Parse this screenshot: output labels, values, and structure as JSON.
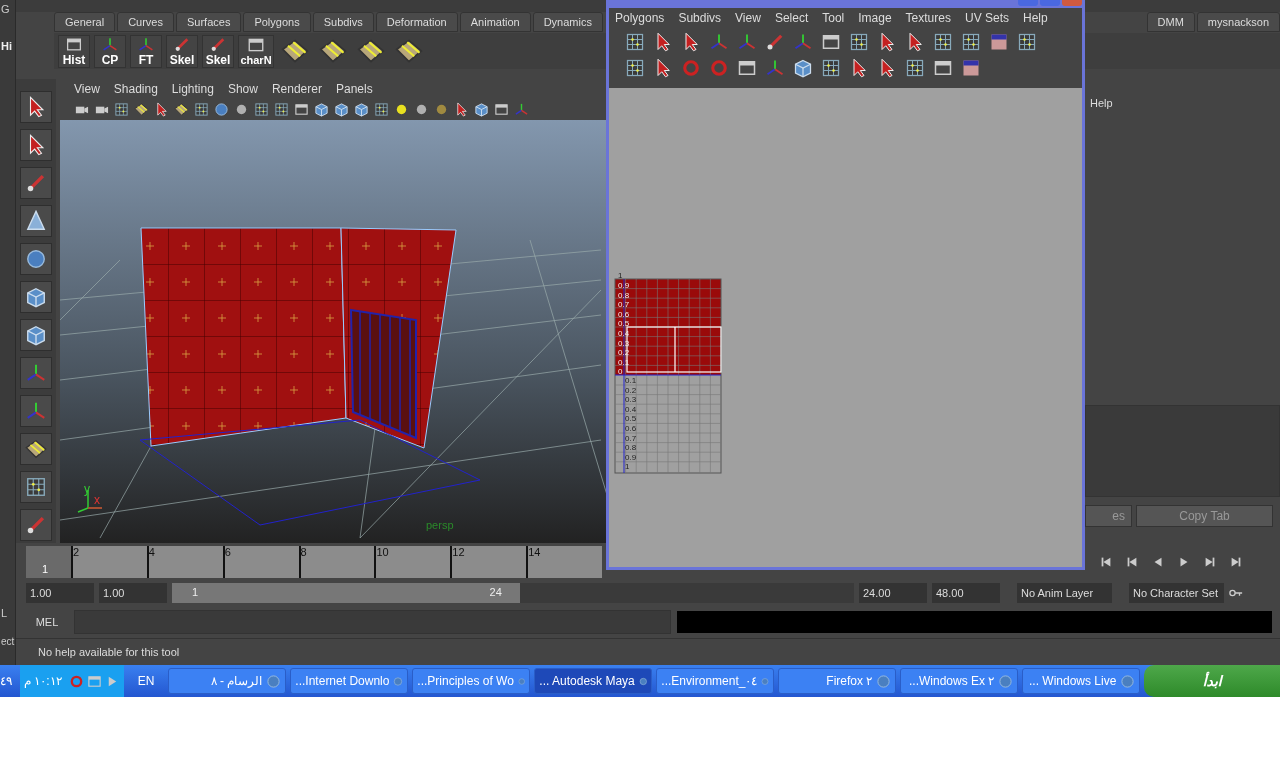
{
  "left_edge": {
    "texts": [
      "G",
      "Hi",
      "L",
      "ect"
    ]
  },
  "shelf": {
    "tabs": [
      "General",
      "Curves",
      "Surfaces",
      "Polygons",
      "Subdivs",
      "Deformation",
      "Animation",
      "Dynamics"
    ],
    "right_tabs": [
      "DMM",
      "mysnackson"
    ],
    "buttons": [
      "Hist",
      "CP",
      "FT",
      "Skel",
      "Skel",
      "charN"
    ]
  },
  "viewport": {
    "menu": [
      "View",
      "Shading",
      "Lighting",
      "Show",
      "Renderer",
      "Panels"
    ],
    "camera_label": "persp",
    "axis_labels": [
      "y",
      "x"
    ]
  },
  "uv_editor": {
    "menu": [
      "Polygons",
      "Subdivs",
      "View",
      "Select",
      "Tool",
      "Image",
      "Textures",
      "UV Sets",
      "Help"
    ],
    "top_label": "1",
    "v_labels_upper": [
      "0.9",
      "0.8",
      "0.7",
      "0.6",
      "0.5",
      "0.4",
      "0.3",
      "0.2",
      "0.1",
      "0"
    ],
    "v_labels_lower": [
      "0.1",
      "0.2",
      "0.3",
      "0.4",
      "0.5",
      "0.6",
      "0.7",
      "0.8",
      "0.9",
      "1"
    ]
  },
  "attribute_panel": {
    "label": "Help",
    "buttons": [
      "es",
      "Copy Tab"
    ]
  },
  "time_slider": {
    "current": "1",
    "level": 0,
    "ticks": [
      "2",
      "4",
      "6",
      "8",
      "10",
      "12",
      "14"
    ]
  },
  "range": {
    "start": "1.00",
    "range_start": "1.00",
    "slider_start": "1",
    "slider_end": "24",
    "level": 0.51,
    "range_end": "24.00",
    "end": "48.00",
    "anim_layer": "No Anim Layer",
    "character_set": "No Character Set"
  },
  "command_line": {
    "label": "MEL"
  },
  "help_line": {
    "text": "No help available for this tool"
  },
  "taskbar": {
    "edge_text": "٤٩",
    "clock": "١٠:١٢ م",
    "language": "EN",
    "start": "ابدأ",
    "items": [
      {
        "label": "الرسام - ٨",
        "selected": false
      },
      {
        "label": "...Internet Downlo",
        "selected": false
      },
      {
        "label": "...Principles of Wo",
        "selected": false
      },
      {
        "label": "... Autodesk Maya",
        "selected": true
      },
      {
        "label": "...Environment_٠٤",
        "selected": false
      },
      {
        "label": "Firefox ٢",
        "selected": false
      },
      {
        "label": "...Windows Ex ٢",
        "selected": false
      },
      {
        "label": "... Windows Live",
        "selected": false
      }
    ]
  }
}
